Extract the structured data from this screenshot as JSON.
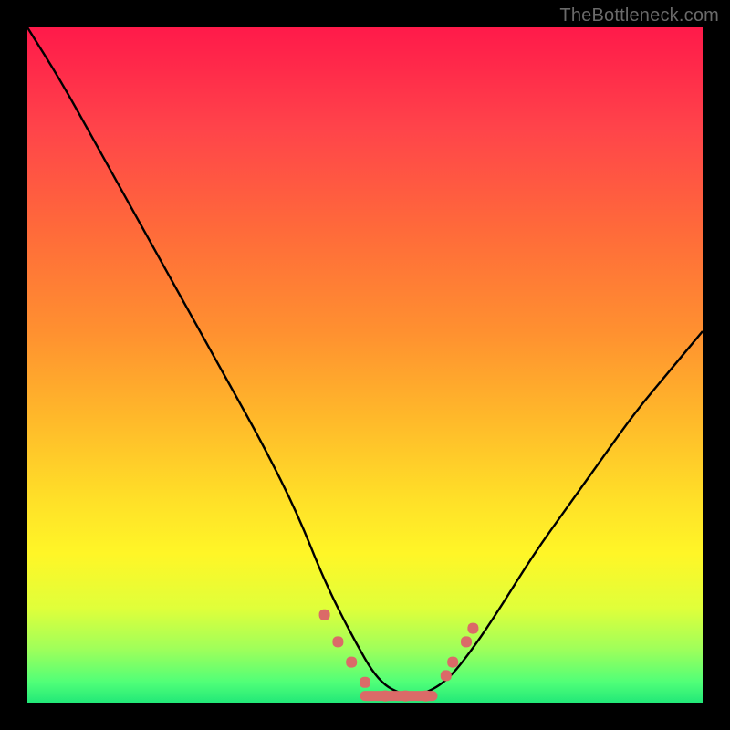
{
  "watermark": "TheBottleneck.com",
  "chart_data": {
    "type": "line",
    "title": "",
    "xlabel": "",
    "ylabel": "",
    "xlim": [
      0,
      100
    ],
    "ylim": [
      0,
      100
    ],
    "background_gradient": {
      "direction": "vertical",
      "stops": [
        {
          "pos": 0,
          "color": "#ff1a4a",
          "meaning": "high"
        },
        {
          "pos": 50,
          "color": "#ffb92a",
          "meaning": "mid"
        },
        {
          "pos": 78,
          "color": "#fff627",
          "meaning": "low-yellow"
        },
        {
          "pos": 100,
          "color": "#22e878",
          "meaning": "optimal"
        }
      ]
    },
    "series": [
      {
        "name": "bottleneck-curve",
        "color": "#000000",
        "x": [
          0,
          5,
          10,
          15,
          20,
          25,
          30,
          35,
          40,
          44,
          48,
          52,
          56,
          58,
          62,
          66,
          70,
          75,
          80,
          85,
          90,
          95,
          100
        ],
        "y": [
          100,
          92,
          83,
          74,
          65,
          56,
          47,
          38,
          28,
          18,
          10,
          3,
          1,
          1,
          3,
          8,
          14,
          22,
          29,
          36,
          43,
          49,
          55
        ]
      }
    ],
    "trough": {
      "x_start": 50,
      "x_end": 60,
      "y": 1
    },
    "markers": {
      "color": "#db6a68",
      "shape": "rounded-dot",
      "points": [
        {
          "x": 44,
          "y": 13
        },
        {
          "x": 46,
          "y": 9
        },
        {
          "x": 48,
          "y": 6
        },
        {
          "x": 50,
          "y": 3
        },
        {
          "x": 53,
          "y": 1
        },
        {
          "x": 56,
          "y": 1
        },
        {
          "x": 59,
          "y": 1
        },
        {
          "x": 62,
          "y": 4
        },
        {
          "x": 63,
          "y": 6
        },
        {
          "x": 65,
          "y": 9
        },
        {
          "x": 66,
          "y": 11
        }
      ]
    },
    "bottom_accent_bars": [
      {
        "y": 96.8,
        "color": "#fbff6a"
      },
      {
        "y": 97.8,
        "color": "#e0ff4a"
      },
      {
        "y": 98.8,
        "color": "#a0ff5a"
      },
      {
        "y": 99.5,
        "color": "#50e870"
      }
    ]
  }
}
